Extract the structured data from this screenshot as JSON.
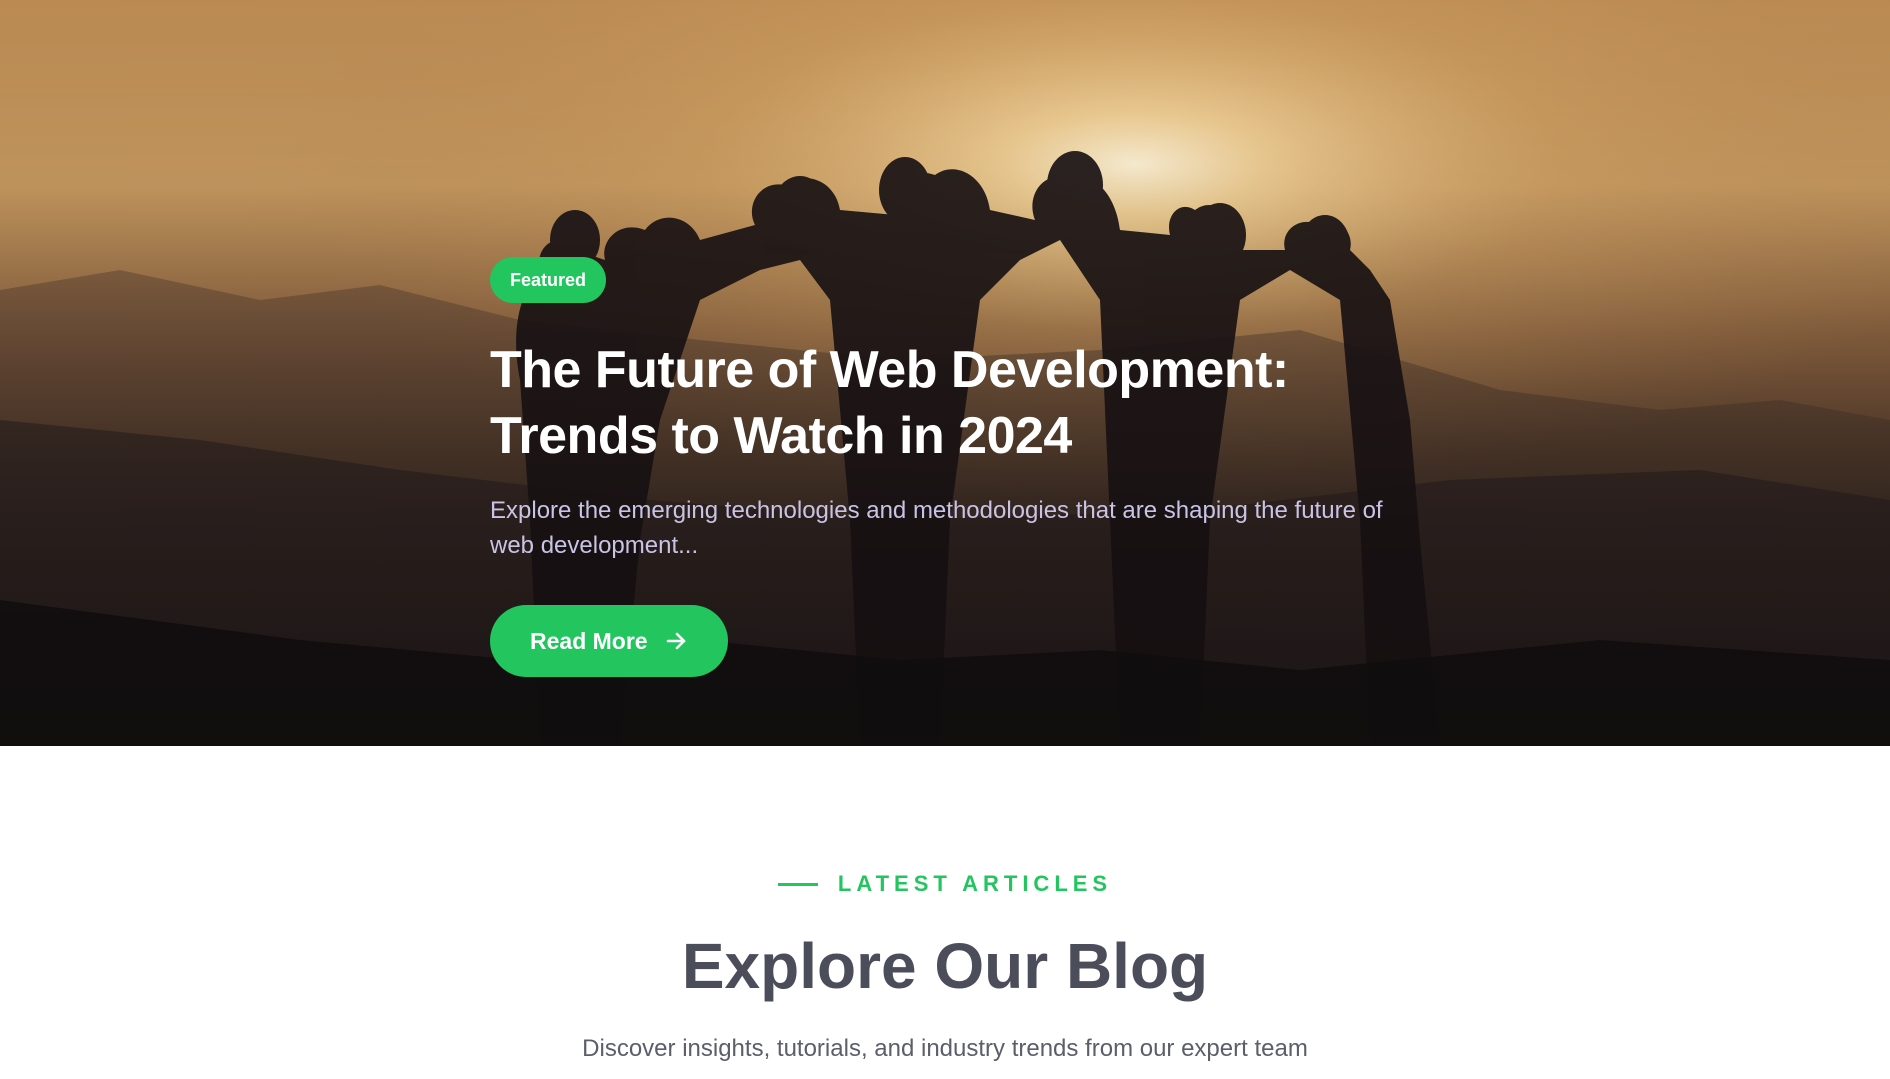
{
  "hero": {
    "badge": "Featured",
    "title": "The Future of Web Development: Trends to Watch in 2024",
    "excerpt": "Explore the emerging technologies and methodologies that are shaping the future of web development...",
    "cta_label": "Read More",
    "cta_icon": "arrow-right-icon"
  },
  "latest": {
    "eyebrow": "LATEST ARTICLES",
    "title": "Explore Our Blog",
    "subtitle": "Discover insights, tutorials, and industry trends from our expert team"
  },
  "colors": {
    "accent": "#22c55e",
    "heading": "#4b4d5a",
    "excerpt": "#c9c3e6"
  }
}
